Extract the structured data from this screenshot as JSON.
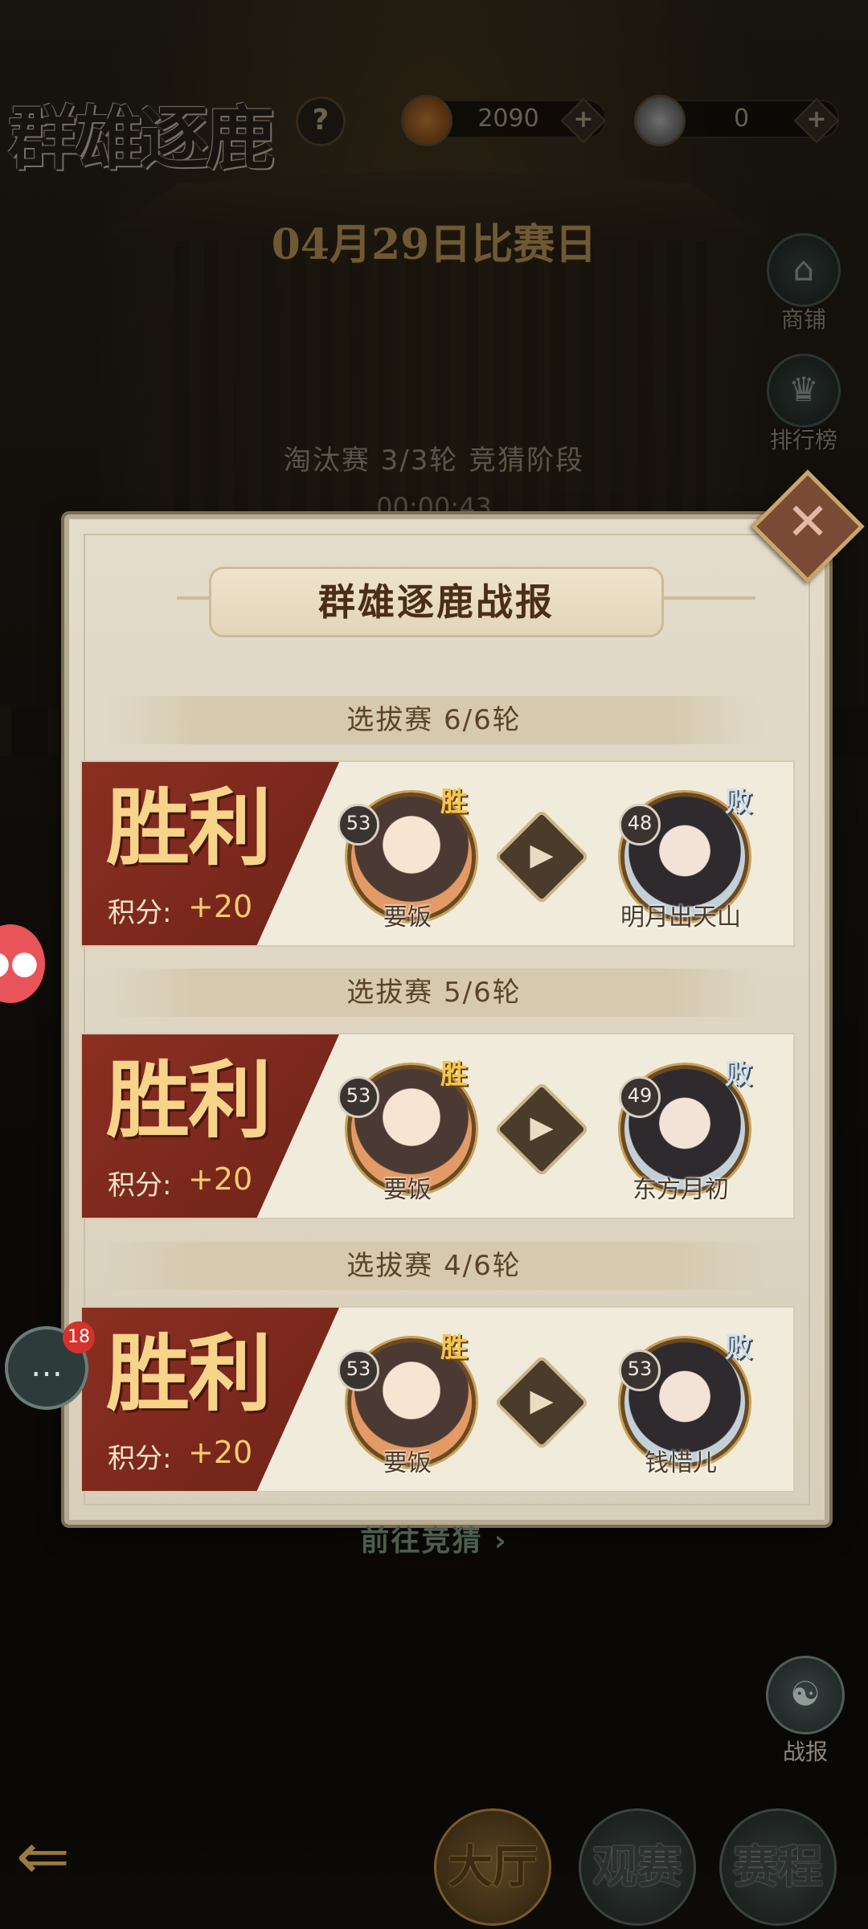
{
  "header": {
    "title": "群雄逐鹿",
    "help_icon": "?",
    "resources": [
      {
        "icon": "coin-icon",
        "value": "2090"
      },
      {
        "icon": "horse-token-icon",
        "value": "0"
      }
    ],
    "date_banner": "04月29日比赛日",
    "side_buttons": [
      {
        "label": "商铺",
        "icon": "shop-icon"
      },
      {
        "label": "排行榜",
        "icon": "ranking-icon"
      }
    ],
    "round_info": "淘汰赛 3/3轮  竞猜阶段",
    "timer": "00:00:43"
  },
  "dialog": {
    "title": "群雄逐鹿战报",
    "close_icon": "✕",
    "matches": [
      {
        "round": "选拔赛 6/6轮",
        "result": "胜利",
        "score_label": "积分:",
        "score_value": "+20",
        "left_player": {
          "name": "要饭",
          "level": "53",
          "tag": "胜"
        },
        "right_player": {
          "name": "明月出天山",
          "level": "48",
          "tag": "败"
        }
      },
      {
        "round": "选拔赛 5/6轮",
        "result": "胜利",
        "score_label": "积分:",
        "score_value": "+20",
        "left_player": {
          "name": "要饭",
          "level": "53",
          "tag": "胜"
        },
        "right_player": {
          "name": "东方月初",
          "level": "49",
          "tag": "败"
        }
      },
      {
        "round": "选拔赛 4/6轮",
        "result": "胜利",
        "score_label": "积分:",
        "score_value": "+20",
        "left_player": {
          "name": "要饭",
          "level": "53",
          "tag": "胜"
        },
        "right_player": {
          "name": "钱惜儿",
          "level": "53",
          "tag": "败"
        }
      }
    ]
  },
  "goto_guess": "前往竞猜 ›",
  "chat_badge": "18",
  "report_button": {
    "label": "战报",
    "icon": "report-icon"
  },
  "bottom_tabs": [
    {
      "label": "大厅",
      "active": true
    },
    {
      "label": "观赛",
      "active": false
    },
    {
      "label": "赛程",
      "active": false
    }
  ],
  "colors": {
    "accent": "#8b2f22",
    "gold": "#f6d48a",
    "panel": "#e4dccb"
  }
}
